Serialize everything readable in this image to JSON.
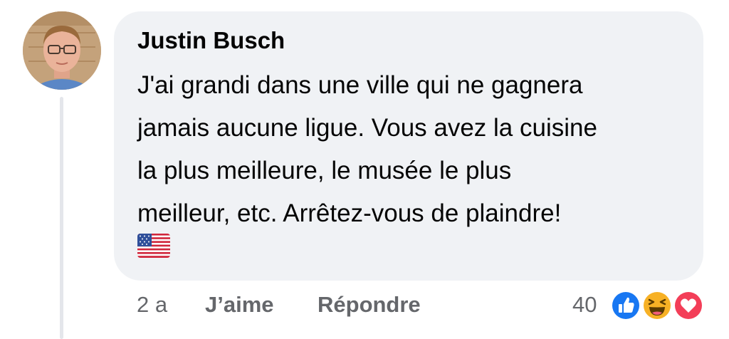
{
  "comment": {
    "author": "Justin Busch",
    "lines": [
      "J'ai grandi dans une ville qui ne gagnera",
      "jamais aucune ligue. Vous avez la cuisine",
      "la plus meilleure, le musée le plus",
      "meilleur, etc. Arrêtez-vous de plaindre!"
    ],
    "flag_icon": "us-flag-emoji"
  },
  "actions": {
    "time": "2 a",
    "like_label": "J’aime",
    "reply_label": "Répondre"
  },
  "reactions": {
    "count": "40",
    "icons": [
      "like-icon",
      "haha-icon",
      "love-icon"
    ]
  },
  "colors": {
    "bubble": "#f0f2f5",
    "text": "#050505",
    "secondary": "#65676b",
    "like_blue": "#1877f2",
    "love_red": "#f33e58",
    "haha_yellow": "#f7b125"
  }
}
